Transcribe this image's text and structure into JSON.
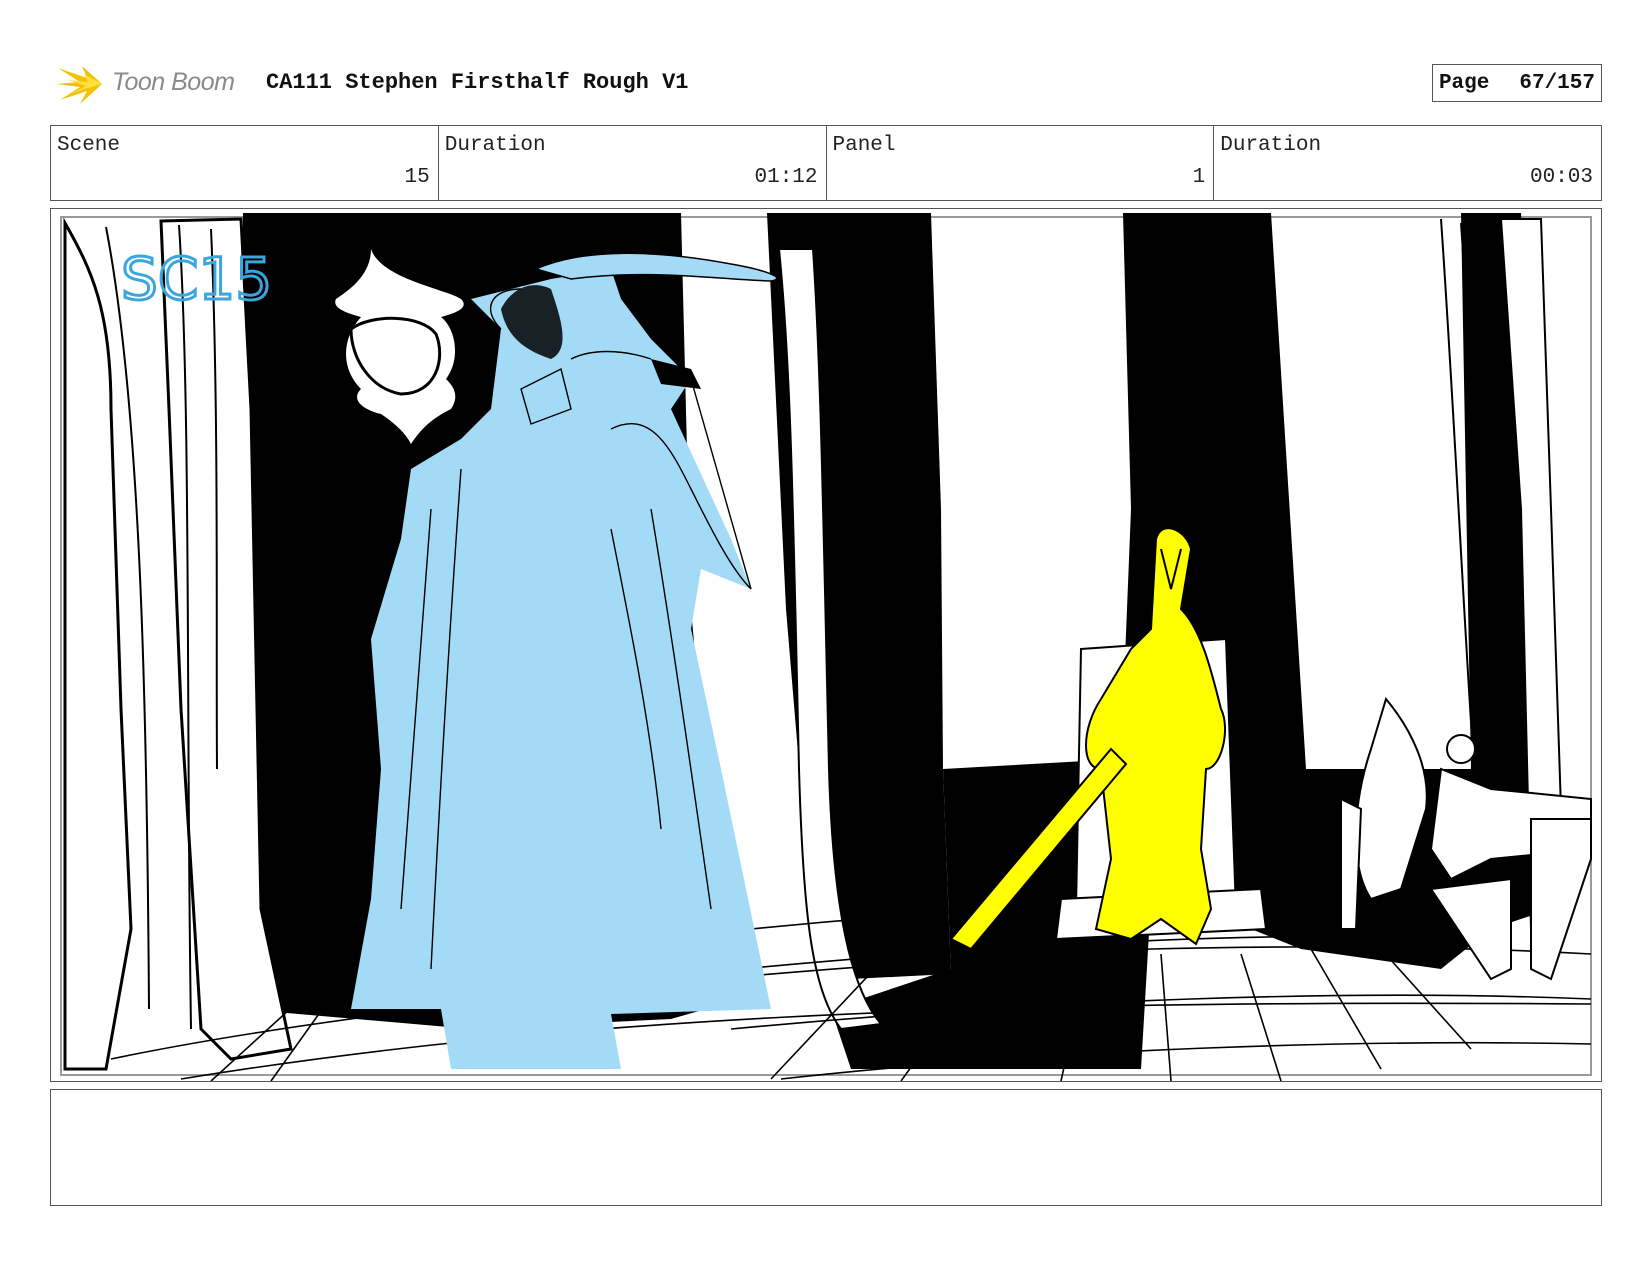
{
  "header": {
    "logo_text": "Toon Boom",
    "title": "CA111 Stephen Firsthalf Rough V1",
    "page_label": "Page",
    "page_value": "67/157"
  },
  "info": {
    "scene_label": "Scene",
    "scene_value": "15",
    "scene_duration_label": "Duration",
    "scene_duration_value": "01:12",
    "panel_label": "Panel",
    "panel_value": "1",
    "panel_duration_label": "Duration",
    "panel_duration_value": "00:03"
  },
  "panel_art": {
    "handwritten_scene_mark": "SC15",
    "colors": {
      "blue_figure": "#a3dbf7",
      "yellow_figure": "#ffff00",
      "mark_blue": "#3aa6de",
      "ink": "#000000"
    }
  },
  "notes": {
    "text": ""
  }
}
